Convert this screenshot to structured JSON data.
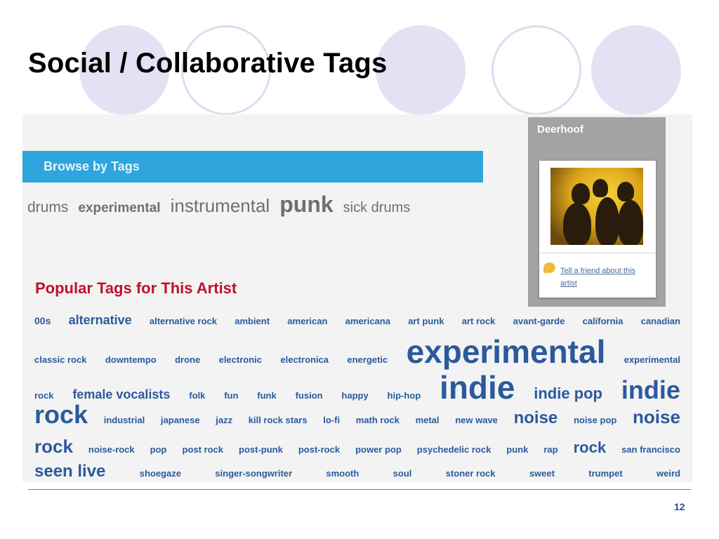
{
  "slide": {
    "title": "Social / Collaborative Tags",
    "number": "12"
  },
  "screenshot": {
    "browse_bar": {
      "label": "Browse by Tags"
    },
    "browse_tags": [
      {
        "label": "drums",
        "size": 21,
        "weight": "normal"
      },
      {
        "label": "experimental",
        "size": 19,
        "weight": "bold"
      },
      {
        "label": "instrumental",
        "size": 26,
        "weight": "normal"
      },
      {
        "label": "punk",
        "size": 32,
        "weight": "bold"
      },
      {
        "label": "sick drums",
        "size": 20,
        "weight": "normal"
      }
    ],
    "popular_heading": "Popular Tags for This Artist",
    "artist": {
      "name": "Deerhoof",
      "tell_friend": "Tell a friend about this artist"
    },
    "tag_cloud_lines": [
      [
        {
          "label": "00s",
          "size": 14
        },
        {
          "label": "alternative",
          "size": 18
        },
        {
          "label": "alternative rock",
          "size": 13
        },
        {
          "label": "ambient",
          "size": 13
        },
        {
          "label": "american",
          "size": 13
        },
        {
          "label": "americana",
          "size": 13
        },
        {
          "label": "art punk",
          "size": 13
        },
        {
          "label": "art rock",
          "size": 13
        },
        {
          "label": "avant-garde",
          "size": 13
        },
        {
          "label": "california",
          "size": 13
        },
        {
          "label": "canadian",
          "size": 13
        }
      ],
      [
        {
          "label": "classic rock",
          "size": 13
        },
        {
          "label": "downtempo",
          "size": 13
        },
        {
          "label": "drone",
          "size": 13
        },
        {
          "label": "electronic",
          "size": 13
        },
        {
          "label": "electronica",
          "size": 13
        },
        {
          "label": "energetic",
          "size": 13
        },
        {
          "label": "experimental",
          "size": 46
        },
        {
          "label": "experimental",
          "size": 13
        }
      ],
      [
        {
          "label": "rock",
          "size": 13
        },
        {
          "label": "female vocalists",
          "size": 18
        },
        {
          "label": "folk",
          "size": 13
        },
        {
          "label": "fun",
          "size": 13
        },
        {
          "label": "funk",
          "size": 13
        },
        {
          "label": "fusion",
          "size": 13
        },
        {
          "label": "happy",
          "size": 13
        },
        {
          "label": "hip-hop",
          "size": 13
        },
        {
          "label": "indie",
          "size": 46
        },
        {
          "label": "indie pop",
          "size": 22
        },
        {
          "label": "indie",
          "size": 36
        }
      ],
      [
        {
          "label": "rock",
          "size": 36
        },
        {
          "label": "industrial",
          "size": 13
        },
        {
          "label": "japanese",
          "size": 13
        },
        {
          "label": "jazz",
          "size": 13
        },
        {
          "label": "kill rock stars",
          "size": 13
        },
        {
          "label": "lo-fi",
          "size": 13
        },
        {
          "label": "math rock",
          "size": 13
        },
        {
          "label": "metal",
          "size": 13
        },
        {
          "label": "new wave",
          "size": 13
        },
        {
          "label": "noise",
          "size": 24
        },
        {
          "label": "noise pop",
          "size": 13
        },
        {
          "label": "noise",
          "size": 26
        }
      ],
      [
        {
          "label": "rock",
          "size": 26
        },
        {
          "label": "noise-rock",
          "size": 13
        },
        {
          "label": "pop",
          "size": 13
        },
        {
          "label": "post rock",
          "size": 13
        },
        {
          "label": "post-punk",
          "size": 13
        },
        {
          "label": "post-rock",
          "size": 13
        },
        {
          "label": "power pop",
          "size": 13
        },
        {
          "label": "psychedelic rock",
          "size": 13
        },
        {
          "label": "punk",
          "size": 13
        },
        {
          "label": "rap",
          "size": 13
        },
        {
          "label": "rock",
          "size": 22
        },
        {
          "label": "san francisco",
          "size": 13
        }
      ],
      [
        {
          "label": "seen live",
          "size": 24
        },
        {
          "label": "shoegaze",
          "size": 13
        },
        {
          "label": "singer-songwriter",
          "size": 13
        },
        {
          "label": "smooth",
          "size": 13
        },
        {
          "label": "soul",
          "size": 13
        },
        {
          "label": "stoner rock",
          "size": 13
        },
        {
          "label": "sweet",
          "size": 13
        },
        {
          "label": "trumpet",
          "size": 13
        },
        {
          "label": "weird",
          "size": 13
        }
      ]
    ]
  },
  "colors": {
    "title": "#000000",
    "browse_bar": "#2ea5dd",
    "tag_blue": "#2b5a9c",
    "popular_heading": "#c0102e",
    "slide_number": "#2c4f9c"
  }
}
